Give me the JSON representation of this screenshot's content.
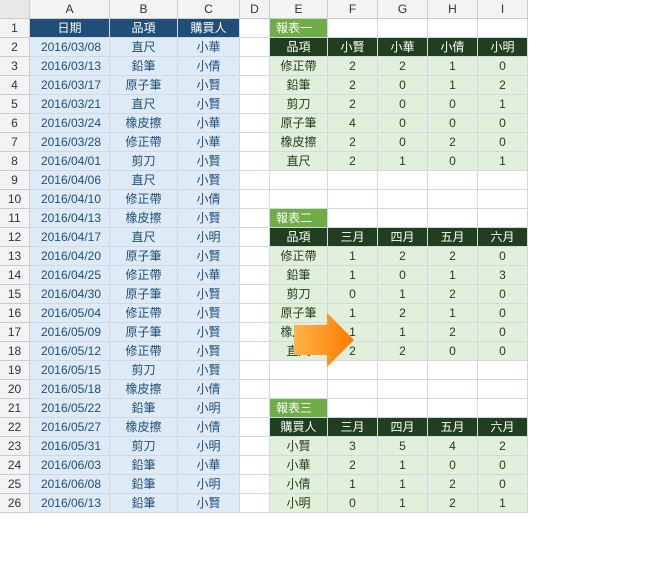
{
  "columns": [
    "A",
    "B",
    "C",
    "D",
    "E",
    "F",
    "G",
    "H",
    "I"
  ],
  "rows": 26,
  "source_headers": {
    "date": "日期",
    "item": "品項",
    "buyer": "購買人"
  },
  "source": [
    {
      "date": "2016/03/08",
      "item": "直尺",
      "buyer": "小華"
    },
    {
      "date": "2016/03/13",
      "item": "鉛筆",
      "buyer": "小倩"
    },
    {
      "date": "2016/03/17",
      "item": "原子筆",
      "buyer": "小賢"
    },
    {
      "date": "2016/03/21",
      "item": "直尺",
      "buyer": "小賢"
    },
    {
      "date": "2016/03/24",
      "item": "橡皮擦",
      "buyer": "小華"
    },
    {
      "date": "2016/03/28",
      "item": "修正帶",
      "buyer": "小華"
    },
    {
      "date": "2016/04/01",
      "item": "剪刀",
      "buyer": "小賢"
    },
    {
      "date": "2016/04/06",
      "item": "直尺",
      "buyer": "小賢"
    },
    {
      "date": "2016/04/10",
      "item": "修正帶",
      "buyer": "小倩"
    },
    {
      "date": "2016/04/13",
      "item": "橡皮擦",
      "buyer": "小賢"
    },
    {
      "date": "2016/04/17",
      "item": "直尺",
      "buyer": "小明"
    },
    {
      "date": "2016/04/20",
      "item": "原子筆",
      "buyer": "小賢"
    },
    {
      "date": "2016/04/25",
      "item": "修正帶",
      "buyer": "小華"
    },
    {
      "date": "2016/04/30",
      "item": "原子筆",
      "buyer": "小賢"
    },
    {
      "date": "2016/05/04",
      "item": "修正帶",
      "buyer": "小賢"
    },
    {
      "date": "2016/05/09",
      "item": "原子筆",
      "buyer": "小賢"
    },
    {
      "date": "2016/05/12",
      "item": "修正帶",
      "buyer": "小賢"
    },
    {
      "date": "2016/05/15",
      "item": "剪刀",
      "buyer": "小賢"
    },
    {
      "date": "2016/05/18",
      "item": "橡皮擦",
      "buyer": "小倩"
    },
    {
      "date": "2016/05/22",
      "item": "鉛筆",
      "buyer": "小明"
    },
    {
      "date": "2016/05/27",
      "item": "橡皮擦",
      "buyer": "小倩"
    },
    {
      "date": "2016/05/31",
      "item": "剪刀",
      "buyer": "小明"
    },
    {
      "date": "2016/06/03",
      "item": "鉛筆",
      "buyer": "小華"
    },
    {
      "date": "2016/06/08",
      "item": "鉛筆",
      "buyer": "小明"
    },
    {
      "date": "2016/06/13",
      "item": "鉛筆",
      "buyer": "小賢"
    }
  ],
  "report1": {
    "title": "報表一",
    "cols": [
      "品項",
      "小賢",
      "小華",
      "小倩",
      "小明"
    ],
    "rows": [
      [
        "修正帶",
        2,
        2,
        1,
        0
      ],
      [
        "鉛筆",
        2,
        0,
        1,
        2
      ],
      [
        "剪刀",
        2,
        0,
        0,
        1
      ],
      [
        "原子筆",
        4,
        0,
        0,
        0
      ],
      [
        "橡皮擦",
        2,
        0,
        2,
        0
      ],
      [
        "直尺",
        2,
        1,
        0,
        1
      ]
    ]
  },
  "report2": {
    "title": "報表二",
    "cols": [
      "品項",
      "三月",
      "四月",
      "五月",
      "六月"
    ],
    "rows": [
      [
        "修正帶",
        1,
        2,
        2,
        0
      ],
      [
        "鉛筆",
        1,
        0,
        1,
        3
      ],
      [
        "剪刀",
        0,
        1,
        2,
        0
      ],
      [
        "原子筆",
        1,
        2,
        1,
        0
      ],
      [
        "橡皮擦",
        1,
        1,
        2,
        0
      ],
      [
        "直尺",
        2,
        2,
        0,
        0
      ]
    ]
  },
  "report3": {
    "title": "報表三",
    "cols": [
      "購買人",
      "三月",
      "四月",
      "五月",
      "六月"
    ],
    "rows": [
      [
        "小賢",
        3,
        5,
        4,
        2
      ],
      [
        "小華",
        2,
        1,
        0,
        0
      ],
      [
        "小倩",
        1,
        1,
        2,
        0
      ],
      [
        "小明",
        0,
        1,
        2,
        1
      ]
    ]
  }
}
